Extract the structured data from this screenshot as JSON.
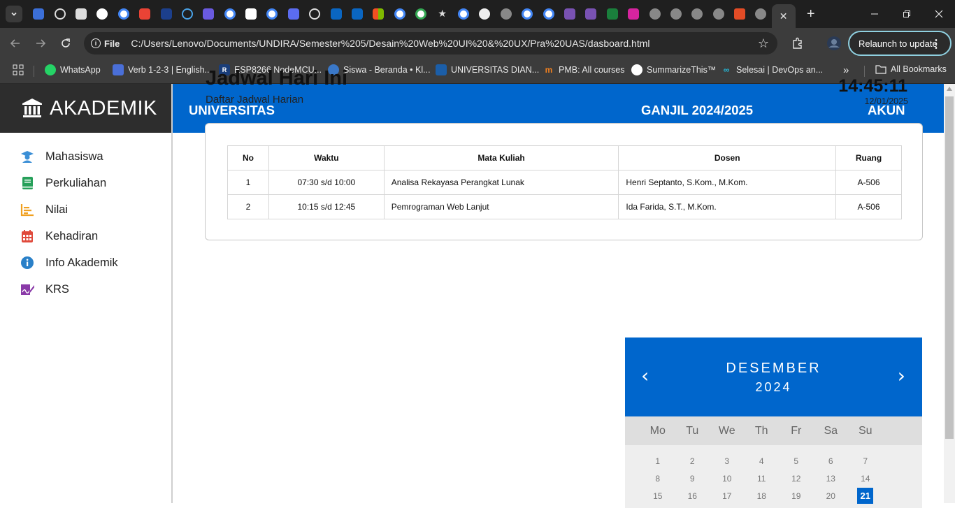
{
  "browser": {
    "active_tab_close": "✕",
    "new_tab": "+",
    "url_scheme": "File",
    "url": "C:/Users/Lenovo/Documents/UNDIRA/Semester%205/Desain%20Web%20UI%20&%20UX/Pra%20UAS/dasboard.html",
    "relaunch_label": "Relaunch to update",
    "bookmarks": [
      {
        "label": "WhatsApp",
        "color": "#25d366"
      },
      {
        "label": "Verb 1-2-3 | English...",
        "color": "#4a6fd8"
      },
      {
        "label": "ESP8266 NodeMCU...",
        "color": "#1a3e7a"
      },
      {
        "label": "Siswa - Beranda • Kl...",
        "color": "#3a78c8"
      },
      {
        "label": "UNIVERSITAS DIAN...",
        "color": "#1b5ea8"
      },
      {
        "label": "PMB: All courses",
        "color": "#f08020"
      },
      {
        "label": "SummarizeThis™",
        "color": "#ffffff"
      },
      {
        "label": "Selesai | DevOps an...",
        "color": "#25b8d8"
      }
    ],
    "bookmarks_more": "»",
    "all_bookmarks": "All Bookmarks"
  },
  "sidebar": {
    "brand": "AKADEMIK",
    "items": [
      {
        "label": "Mahasiswa",
        "icon": "graduate-icon",
        "color": "#3b8fd6"
      },
      {
        "label": "Perkuliahan",
        "icon": "book-icon",
        "color": "#27a05a"
      },
      {
        "label": "Nilai",
        "icon": "bar-chart-icon",
        "color": "#f0a020"
      },
      {
        "label": "Kehadiran",
        "icon": "calendar-icon",
        "color": "#e04a3c"
      },
      {
        "label": "Info Akademik",
        "icon": "info-icon",
        "color": "#2a80c8"
      },
      {
        "label": "KRS",
        "icon": "signature-icon",
        "color": "#8a3aa8"
      }
    ]
  },
  "topbar": {
    "left": "UNIVERSITAS",
    "semester": "GANJIL 2024/2025",
    "account": "AKUN"
  },
  "main": {
    "title": "Jadwal Hari Ini",
    "subtitle": "Daftar Jadwal Harian",
    "time": "14:45:11",
    "date": "12/01/2025"
  },
  "schedule": {
    "headers": [
      "No",
      "Waktu",
      "Mata Kuliah",
      "Dosen",
      "Ruang"
    ],
    "rows": [
      [
        "1",
        "07:30 s/d 10:00",
        "Analisa Rekayasa Perangkat Lunak",
        "Henri Septanto, S.Kom., M.Kom.",
        "A-506"
      ],
      [
        "2",
        "10:15 s/d 12:45",
        "Pemrograman Web Lanjut",
        "Ida Farida, S.T., M.Kom.",
        "A-506"
      ]
    ]
  },
  "calendar": {
    "month": "DESEMBER",
    "year": "2024",
    "prev": "‹",
    "next": "›",
    "weekdays": [
      "Mo",
      "Tu",
      "We",
      "Th",
      "Fr",
      "Sa",
      "Su"
    ],
    "weeks": [
      [
        "1",
        "2",
        "3",
        "4",
        "5",
        "6",
        "7"
      ],
      [
        "8",
        "9",
        "10",
        "11",
        "12",
        "13",
        "14"
      ],
      [
        "15",
        "16",
        "17",
        "18",
        "19",
        "20",
        "21"
      ]
    ],
    "active_day": "21"
  }
}
